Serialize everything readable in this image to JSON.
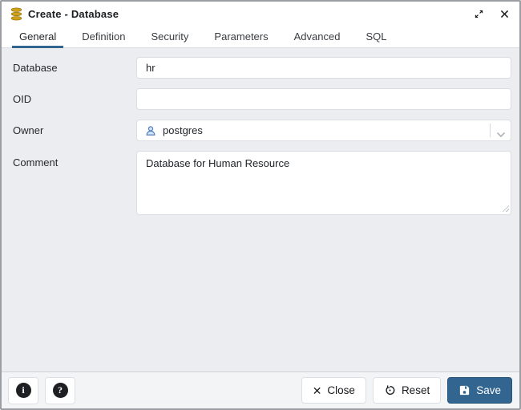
{
  "window": {
    "title": "Create - Database"
  },
  "tabs": [
    {
      "label": "General",
      "active": true
    },
    {
      "label": "Definition",
      "active": false
    },
    {
      "label": "Security",
      "active": false
    },
    {
      "label": "Parameters",
      "active": false
    },
    {
      "label": "Advanced",
      "active": false
    },
    {
      "label": "SQL",
      "active": false
    }
  ],
  "form": {
    "fields": [
      {
        "label": "Database",
        "type": "text",
        "value": "hr"
      },
      {
        "label": "OID",
        "type": "text",
        "value": ""
      },
      {
        "label": "Owner",
        "type": "select",
        "value": "postgres",
        "icon": "user-icon"
      },
      {
        "label": "Comment",
        "type": "textarea",
        "value": "Database for Human Resource"
      }
    ]
  },
  "footer": {
    "info_glyph": "i",
    "help_glyph": "?",
    "close_label": "Close",
    "reset_label": "Reset",
    "save_label": "Save"
  },
  "colors": {
    "accent": "#326690",
    "content_bg": "#ebedf0",
    "db_icon_gold": "#c99a12",
    "owner_icon_blue": "#4b79b8"
  }
}
